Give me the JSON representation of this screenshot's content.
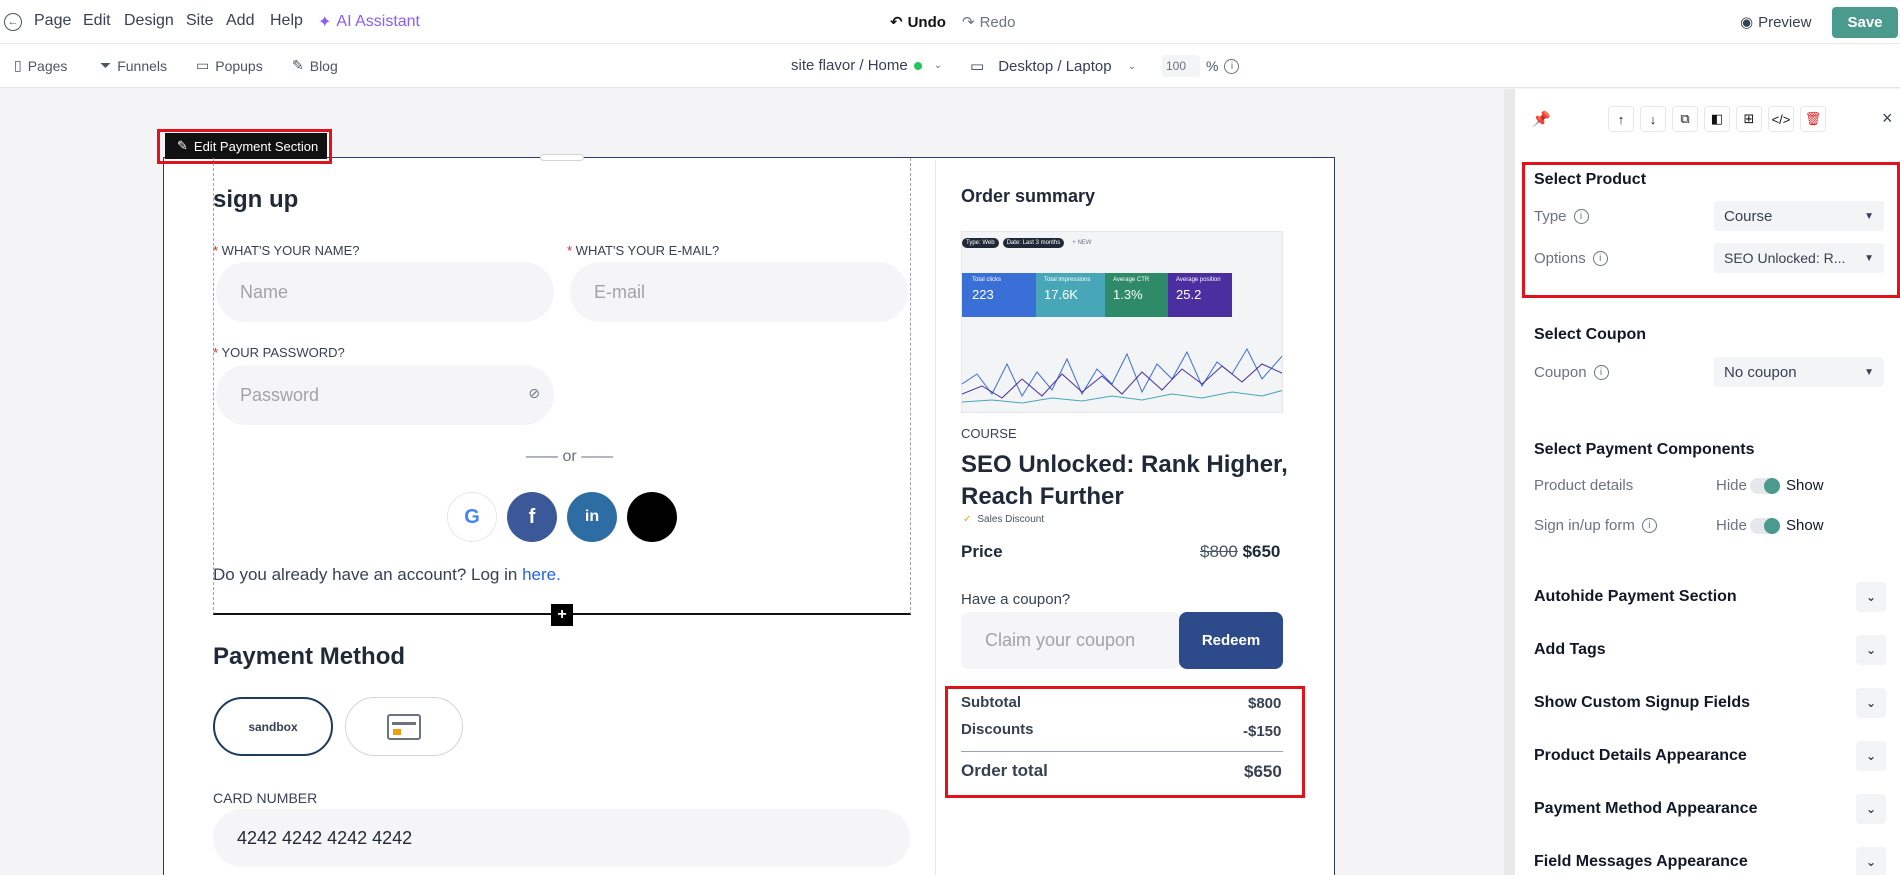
{
  "topbar": {
    "menu": [
      "Page",
      "Edit",
      "Design",
      "Site",
      "Add",
      "Help"
    ],
    "ai_assistant": "AI Assistant",
    "undo": "Undo",
    "redo": "Redo",
    "preview": "Preview",
    "save": "Save"
  },
  "subbar": {
    "pages": "Pages",
    "funnels": "Funnels",
    "popups": "Popups",
    "blog": "Blog",
    "site_path": "site flavor / Home",
    "device": "Desktop / Laptop",
    "zoom": "100",
    "zoom_unit": "%"
  },
  "editor": {
    "edit_tag": "Edit Payment Section"
  },
  "signup": {
    "title": "sign up",
    "name_label": "WHAT'S YOUR NAME?",
    "name_placeholder": "Name",
    "email_label": "WHAT'S YOUR E-MAIL?",
    "email_placeholder": "E-mail",
    "password_label": "YOUR PASSWORD?",
    "password_placeholder": "Password",
    "or_text": "or",
    "login_prompt": "Do you already have an account? Log in",
    "login_link": "here."
  },
  "payment": {
    "title": "Payment Method",
    "sandbox": "sandbox",
    "card_label": "CARD NUMBER",
    "card_value": "4242 4242 4242 4242"
  },
  "order": {
    "title": "Order summary",
    "thumb_tiles": [
      {
        "label": "Total clicks",
        "value": "223",
        "color": "#3b6fd8"
      },
      {
        "label": "Total impressions",
        "value": "17.6K",
        "color": "#47a7b8"
      },
      {
        "label": "Average CTR",
        "value": "1.3%",
        "color": "#2f8a6a"
      },
      {
        "label": "Average position",
        "value": "25.2",
        "color": "#4b2fa0"
      }
    ],
    "thumb_chips": [
      "Type: Web",
      "Date: Last 3 months",
      "+ NEW"
    ],
    "category": "COURSE",
    "product_name": "SEO Unlocked: Rank Higher, Reach Further",
    "discount_tag": "Sales Discount",
    "price_label": "Price",
    "price_old": "$800",
    "price_new": "$650",
    "coupon_label": "Have a coupon?",
    "coupon_placeholder": "Claim your coupon",
    "redeem": "Redeem",
    "subtotal_label": "Subtotal",
    "subtotal_value": "$800",
    "discounts_label": "Discounts",
    "discounts_value": "-$150",
    "total_label": "Order total",
    "total_value": "$650"
  },
  "panel": {
    "select_product": "Select Product",
    "type_label": "Type",
    "type_value": "Course",
    "options_label": "Options",
    "options_value": "SEO Unlocked: R...",
    "select_coupon": "Select Coupon",
    "coupon_label": "Coupon",
    "coupon_value": "No coupon",
    "select_components": "Select Payment Components",
    "product_details": "Product details",
    "signin_form": "Sign in/up form",
    "hide": "Hide",
    "show": "Show",
    "accordions": [
      "Autohide Payment Section",
      "Add Tags",
      "Show Custom Signup Fields",
      "Product Details Appearance",
      "Payment Method Appearance",
      "Field Messages Appearance"
    ]
  },
  "colors": {
    "accent": "#4a9a8e",
    "highlight": "#e0121b",
    "navy": "#2d3a66",
    "ai": "#8b5cf6"
  }
}
